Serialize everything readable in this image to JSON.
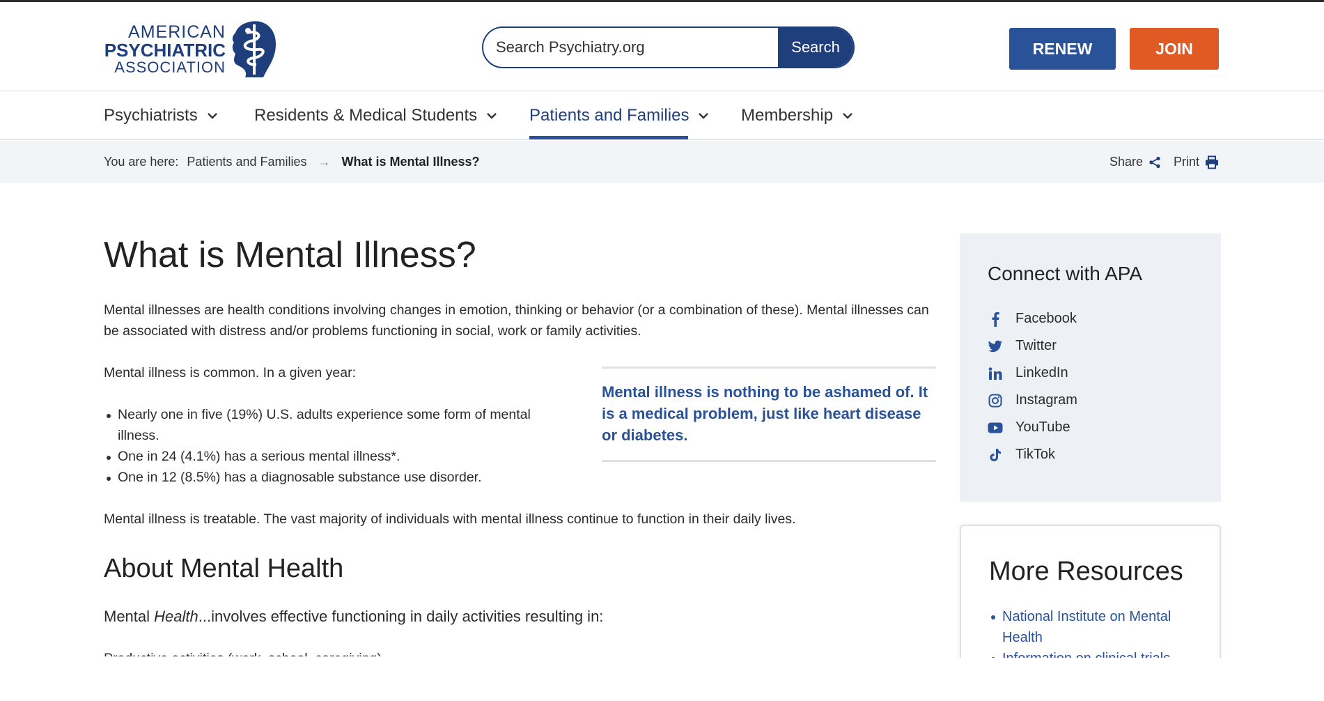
{
  "logo": {
    "line1": "AMERICAN",
    "line2": "PSYCHIATRIC",
    "line3": "ASSOCIATION"
  },
  "search": {
    "placeholder": "Search Psychiatry.org",
    "button_label": "Search"
  },
  "header_buttons": {
    "renew": "RENEW",
    "join": "JOIN"
  },
  "nav": [
    {
      "label": "Psychiatrists"
    },
    {
      "label": "Residents & Medical Students"
    },
    {
      "label": "Patients and Families",
      "active": true
    },
    {
      "label": "Membership"
    }
  ],
  "breadcrumb": {
    "prefix": "You are here:",
    "items": [
      "Patients and Families",
      "What is Mental Illness?"
    ],
    "separator": "→"
  },
  "tools": {
    "share": "Share",
    "print": "Print"
  },
  "content": {
    "title": "What is Mental Illness?",
    "intro": "Mental illnesses are health conditions involving changes in emotion, thinking or behavior (or a combination of these). Mental illnesses can be associated with distress and/or problems functioning in social, work or family activities.",
    "common": "Mental illness is common. In a given year:",
    "bullets": [
      "Nearly one in five (19%) U.S. adults experience some form of mental illness.",
      "One in 24 (4.1%) has a serious mental illness*.",
      "One in 12 (8.5%) has a diagnosable substance use disorder."
    ],
    "pullquote": "Mental illness is nothing to be ashamed of. It is a medical problem, just like heart disease or diabetes.",
    "treatable": "Mental illness is treatable. The vast majority of individuals with mental illness continue to function in their daily lives.",
    "about_heading": "About Mental Health",
    "mh_prefix": "Mental ",
    "mh_italic": "Health",
    "mh_suffix": "...involves effective functioning in daily activities resulting in:",
    "partial_line": "Productive activities (work, school, caregiving)"
  },
  "connect": {
    "title": "Connect with APA",
    "items": [
      {
        "label": "Facebook",
        "icon": "facebook-icon"
      },
      {
        "label": "Twitter",
        "icon": "twitter-icon"
      },
      {
        "label": "LinkedIn",
        "icon": "linkedin-icon"
      },
      {
        "label": "Instagram",
        "icon": "instagram-icon"
      },
      {
        "label": "YouTube",
        "icon": "youtube-icon"
      },
      {
        "label": "TikTok",
        "icon": "tiktok-icon"
      }
    ]
  },
  "resources": {
    "title": "More Resources",
    "items": [
      "National Institute on Mental Health",
      "Information on clinical trials"
    ]
  },
  "colors": {
    "brand_navy": "#1f3e7c",
    "brand_blue": "#2a5298",
    "join_orange": "#e05a24",
    "sidebar_bg": "#edf0f5"
  }
}
